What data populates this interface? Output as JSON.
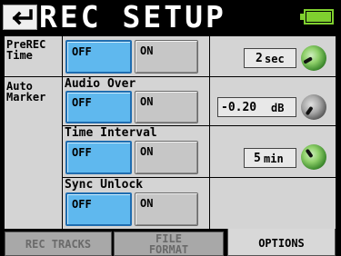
{
  "header": {
    "title": "REC SETUP",
    "back_icon": "back-arrow-icon",
    "battery_icon": "battery-icon",
    "battery_color": "#7fcf2f"
  },
  "prerec": {
    "label_line1": "PreREC",
    "label_line2": "Time",
    "off_label": "OFF",
    "on_label": "ON",
    "selected": "OFF",
    "time_value": "2",
    "time_unit": "sec"
  },
  "auto_marker": {
    "label_line1": "Auto",
    "label_line2": "Marker",
    "audio_over": {
      "label": "Audio Over",
      "off_label": "OFF",
      "on_label": "ON",
      "selected": "OFF",
      "level_value": "-0.20",
      "level_unit": "dB"
    },
    "time_interval": {
      "label": "Time Interval",
      "off_label": "OFF",
      "on_label": "ON",
      "selected": "OFF",
      "interval_value": "5",
      "interval_unit": "min"
    },
    "sync_unlock": {
      "label": "Sync Unlock",
      "off_label": "OFF",
      "on_label": "ON",
      "selected": "OFF"
    }
  },
  "tabs": [
    {
      "label": "REC TRACKS",
      "active": false
    },
    {
      "label_line1": "FILE",
      "label_line2": "FORMAT",
      "active": false
    },
    {
      "label": "OPTIONS",
      "active": true
    }
  ],
  "colors": {
    "selected_button": "#5fb8ee",
    "panel_bg": "#d4d4d4",
    "knob_green": "#5fae3f",
    "knob_gray": "#8a8a8a"
  }
}
